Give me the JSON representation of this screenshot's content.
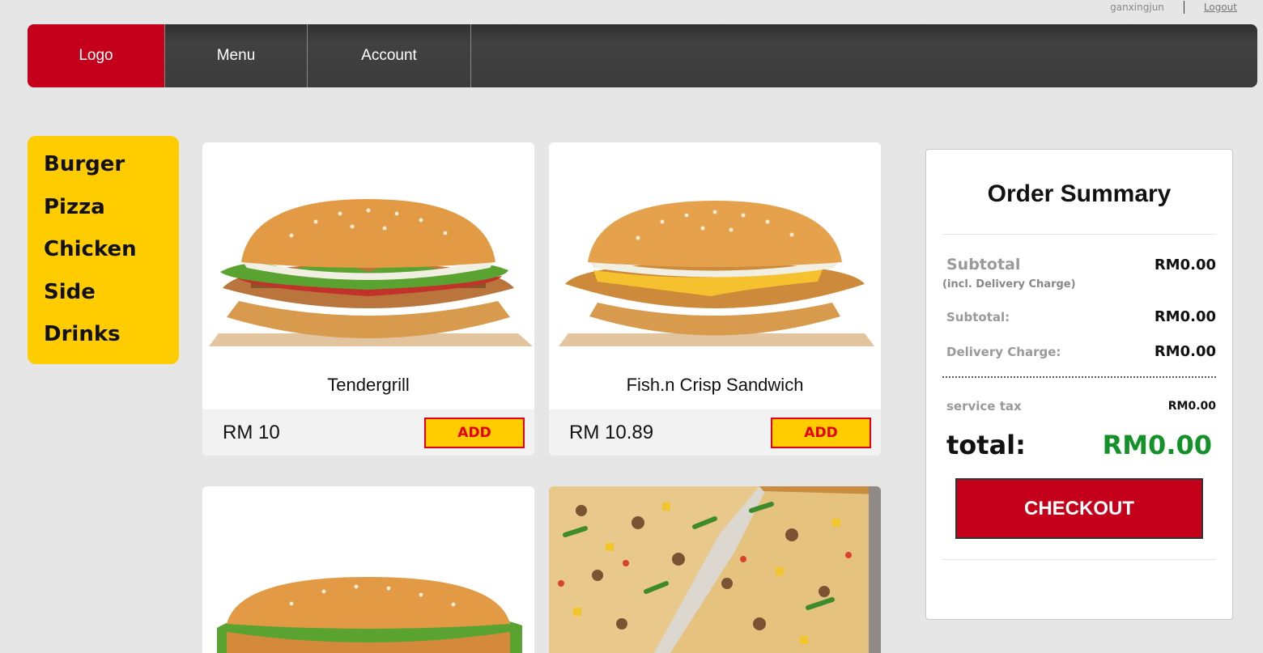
{
  "user": {
    "name": "ganxingjun",
    "logout_label": "Logout"
  },
  "nav": {
    "logo": "Logo",
    "menu": "Menu",
    "account": "Account"
  },
  "categories": [
    "Burger",
    "Pizza",
    "Chicken",
    "Side",
    "Drinks"
  ],
  "products": [
    {
      "name": "Tendergrill",
      "price": "RM 10",
      "add_label": "ADD"
    },
    {
      "name": "Fish.n Crisp Sandwich",
      "price": "RM 10.89",
      "add_label": "ADD"
    }
  ],
  "summary": {
    "title": "Order Summary",
    "subtotal_label": "Subtotal",
    "subtotal_note": "(incl. Delivery Charge)",
    "subtotal_value": "RM0.00",
    "subtotal2_label": "Subtotal:",
    "subtotal2_value": "RM0.00",
    "delivery_label": "Delivery Charge:",
    "delivery_value": "RM0.00",
    "tax_label": "service tax",
    "tax_value": "RM0.00",
    "total_label": "total:",
    "total_value": "RM0.00",
    "checkout_label": "CHECKOUT"
  },
  "colors": {
    "brand_red": "#c4001a",
    "accent_yellow": "#ffcc00",
    "total_green": "#14922a",
    "nav_dark": "#3c3c3c"
  }
}
